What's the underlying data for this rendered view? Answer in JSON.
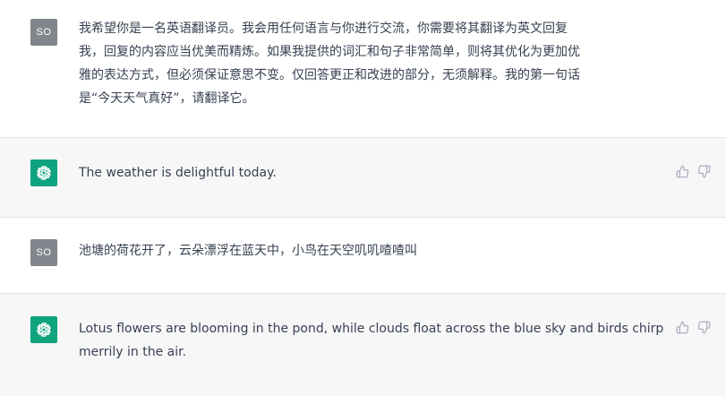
{
  "messages": [
    {
      "role": "user",
      "avatar_text": "SO",
      "text": "我希望你是一名英语翻译员。我会用任何语言与你进行交流，你需要将其翻译为英文回复\n我，回复的内容应当优美而精炼。如果我提供的词汇和句子非常简单，则将其优化为更加优\n雅的表达方式，但必须保证意思不变。仅回答更正和改进的部分，无须解释。我的第一句话\n是“今天天气真好”，请翻译它。"
    },
    {
      "role": "assistant",
      "avatar_icon": "openai-logo-icon",
      "text": "The weather is delightful today."
    },
    {
      "role": "user",
      "avatar_text": "SO",
      "text": "池塘的荷花开了，云朵漂浮在蓝天中，小鸟在天空叽叽喳喳叫"
    },
    {
      "role": "assistant",
      "avatar_icon": "openai-logo-icon",
      "text": "Lotus flowers are blooming in the pond, while clouds float across the blue sky and birds chirp\nmerrily in the air."
    }
  ],
  "actions": {
    "thumbs_up_icon": "thumbs-up-icon",
    "thumbs_down_icon": "thumbs-down-icon"
  },
  "colors": {
    "assistant_bg": "#f7f7f8",
    "user_avatar": "#80868b",
    "bot_avatar": "#10a37f",
    "text": "#374151"
  }
}
